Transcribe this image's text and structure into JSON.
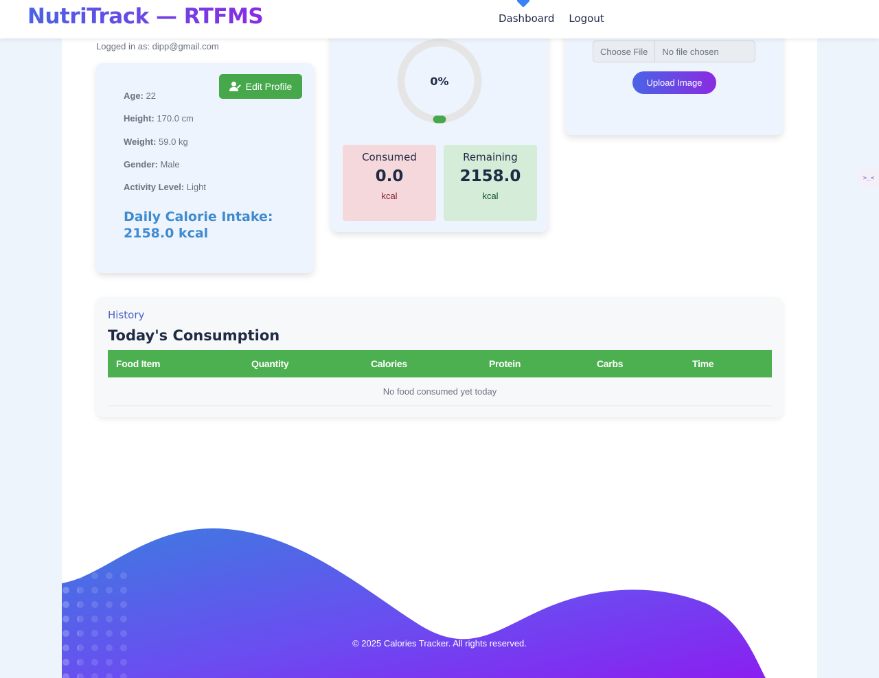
{
  "navbar": {
    "brand": "NutriTrack — RTFMS",
    "links": [
      "Dashboard",
      "Logout"
    ]
  },
  "user": {
    "logged_in_text": "Logged in as: dipp@gmail.com"
  },
  "profile": {
    "edit_label": "Edit Profile",
    "age_label": "Age:",
    "age_value": "22",
    "height_label": "Height:",
    "height_value": "170.0 cm",
    "weight_label": "Weight:",
    "weight_value": "59.0 kg",
    "gender_label": "Gender:",
    "gender_value": "Male",
    "activity_label": "Activity Level:",
    "activity_value": "Light",
    "daily_intake": "Daily Calorie Intake: 2158.0 kcal"
  },
  "progress": {
    "percent_text": "0%",
    "percent_value": 0,
    "consumed_title": "Consumed",
    "consumed_value": "0.0",
    "consumed_unit": "kcal",
    "remaining_title": "Remaining",
    "remaining_value": "2158.0",
    "remaining_unit": "kcal"
  },
  "upload": {
    "choose_label": "Choose File",
    "file_status": "No file chosen",
    "upload_label": "Upload Image"
  },
  "history": {
    "label": "History",
    "title": "Today's Consumption",
    "columns": [
      "Food Item",
      "Quantity",
      "Calories",
      "Protein",
      "Carbs",
      "Time"
    ],
    "empty_text": "No food consumed yet today"
  },
  "footer": {
    "text": "© 2025 Calories Tracker. All rights reserved."
  },
  "colors": {
    "brand_start": "#4a63e6",
    "brand_end": "#8a2be2",
    "accent_green": "#4caf50",
    "intake_blue": "#3f8bd0"
  }
}
